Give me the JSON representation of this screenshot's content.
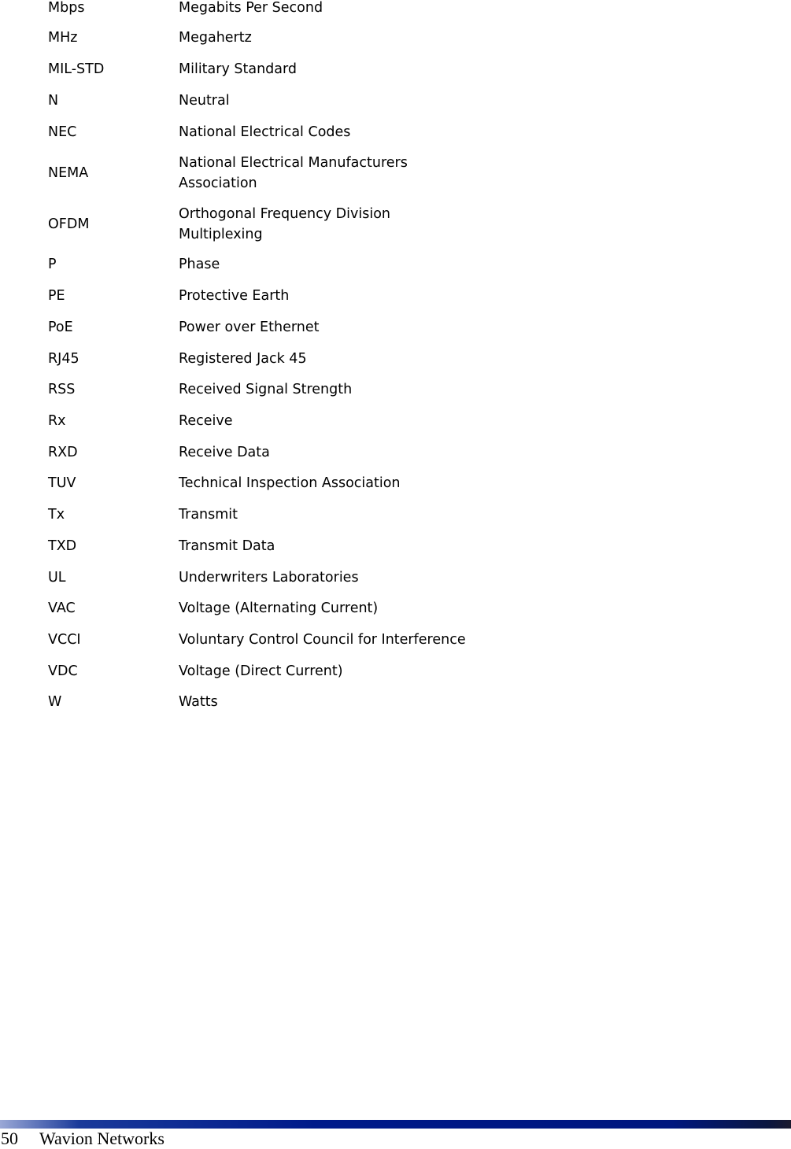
{
  "glossary": [
    {
      "abbr": "Mbps",
      "definition": "Megabits Per Second"
    },
    {
      "abbr": "MHz",
      "definition": "Megahertz"
    },
    {
      "abbr": "MIL-STD",
      "definition": "Military Standard"
    },
    {
      "abbr": "N",
      "definition": "Neutral"
    },
    {
      "abbr": "NEC",
      "definition": "National Electrical Codes"
    },
    {
      "abbr": "NEMA",
      "definition_line1": "National Electrical Manufacturers",
      "definition_line2": "Association"
    },
    {
      "abbr": "OFDM",
      "definition_line1": "Orthogonal Frequency Division",
      "definition_line2": "Multiplexing"
    },
    {
      "abbr": "P",
      "definition": "Phase"
    },
    {
      "abbr": "PE",
      "definition": "Protective Earth"
    },
    {
      "abbr": "PoE",
      "definition": "Power over Ethernet"
    },
    {
      "abbr": "RJ45",
      "definition": "Registered Jack 45"
    },
    {
      "abbr": "RSS",
      "definition": "Received Signal Strength"
    },
    {
      "abbr": "Rx",
      "definition": "Receive"
    },
    {
      "abbr": "RXD",
      "definition": "Receive Data"
    },
    {
      "abbr": "TUV",
      "definition": "Technical Inspection Association"
    },
    {
      "abbr": "Tx",
      "definition": "Transmit"
    },
    {
      "abbr": "TXD",
      "definition": "Transmit Data"
    },
    {
      "abbr": "UL",
      "definition": "Underwriters Laboratories"
    },
    {
      "abbr": "VAC",
      "definition": "Voltage (Alternating Current)"
    },
    {
      "abbr": "VCCI",
      "definition": "Voluntary Control Council for Interference"
    },
    {
      "abbr": "VDC",
      "definition": "Voltage (Direct Current)"
    },
    {
      "abbr": "W",
      "definition": "Watts"
    }
  ],
  "footer": {
    "page_number": "50",
    "company": "Wavion Networks"
  }
}
